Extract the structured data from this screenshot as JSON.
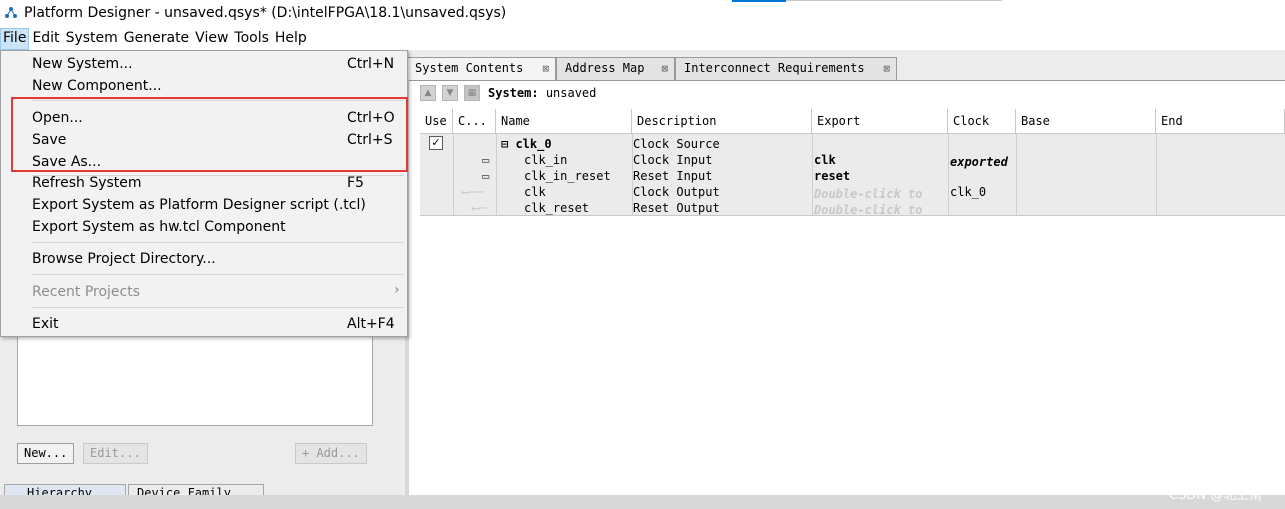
{
  "window": {
    "title": "Platform Designer - unsaved.qsys* (D:\\intelFPGA\\18.1\\unsaved.qsys)",
    "app_icon": "platform-designer-icon"
  },
  "menubar": [
    "File",
    "Edit",
    "System",
    "Generate",
    "View",
    "Tools",
    "Help"
  ],
  "file_menu": {
    "items": [
      {
        "label": "New System...",
        "shortcut": "Ctrl+N"
      },
      {
        "label": "New Component...",
        "shortcut": ""
      },
      {
        "label": "Open...",
        "shortcut": "Ctrl+O"
      },
      {
        "label": "Save",
        "shortcut": "Ctrl+S"
      },
      {
        "label": "Save As...",
        "shortcut": ""
      },
      {
        "label": "Refresh System",
        "shortcut": "F5"
      },
      {
        "label": "Export System as Platform Designer script (.tcl)",
        "shortcut": ""
      },
      {
        "label": "Export System as hw.tcl Component",
        "shortcut": ""
      },
      {
        "label": "Browse Project Directory...",
        "shortcut": ""
      },
      {
        "label": "Recent Projects",
        "shortcut": "›",
        "disabled": true
      },
      {
        "label": "Exit",
        "shortcut": "Alt+F4"
      }
    ],
    "highlight_color": "#e53935"
  },
  "tabs": [
    {
      "label": "System Contents",
      "active": true
    },
    {
      "label": "Address Map"
    },
    {
      "label": "Interconnect Requirements"
    }
  ],
  "tab_close_glyph": "⊠",
  "system": {
    "label": "System:",
    "value": "unsaved"
  },
  "table": {
    "headers": [
      "Use",
      "C...",
      "Name",
      "Description",
      "Export",
      "Clock",
      "Base",
      "End"
    ],
    "rows": [
      {
        "use": "✓",
        "name": "⊟ clk_0",
        "description": "Clock Source",
        "export": "",
        "clock": ""
      },
      {
        "name": "clk_in",
        "description": "Clock Input",
        "export": "clk",
        "clock": "exported"
      },
      {
        "name": "clk_in_reset",
        "description": "Reset Input",
        "export": "reset",
        "clock": ""
      },
      {
        "name": "clk",
        "description": "Clock Output",
        "export": "Double-click to",
        "clock": "clk_0"
      },
      {
        "name": "clk_reset",
        "description": "Reset Output",
        "export": "Double-click to",
        "clock": ""
      }
    ]
  },
  "left_panel": {
    "buttons": {
      "new": "New...",
      "edit": "Edit...",
      "add": "+ Add..."
    },
    "tabs": [
      "Hierarchy",
      "Device Family"
    ]
  },
  "watermark": "CSDN @北上南"
}
